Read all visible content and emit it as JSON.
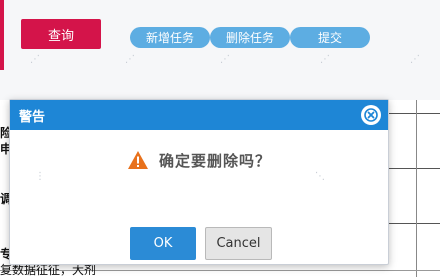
{
  "toolbar": {
    "query_label": "查询",
    "add_task_label": "新增任务",
    "delete_task_label": "删除任务",
    "submit_label": "提交"
  },
  "background": {
    "fragments": [
      "险",
      "申",
      "调",
      "专",
      "复数据征征，大剂"
    ]
  },
  "dialog": {
    "title": "警告",
    "message": "确定要删除吗？",
    "ok_label": "OK",
    "cancel_label": "Cancel"
  },
  "colors": {
    "brand_red": "#d4144a",
    "pill_blue": "#5dade2",
    "dialog_header_blue": "#1e86d6",
    "ok_blue": "#2b8bd6",
    "warning_orange": "#e8711c"
  },
  "icons": [
    "close-icon",
    "warning-icon"
  ]
}
